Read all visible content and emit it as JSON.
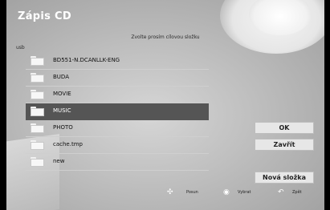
{
  "dialog": {
    "title": "Zápis CD",
    "subtitle": "Zvolte prosím cílovou složku",
    "path": "usb"
  },
  "folders": [
    {
      "label": "BD551-N.DCANLLK-ENG",
      "selected": false
    },
    {
      "label": "BUDA",
      "selected": false
    },
    {
      "label": "MOVIE",
      "selected": false
    },
    {
      "label": "MUSIC",
      "selected": true
    },
    {
      "label": "PHOTO",
      "selected": false
    },
    {
      "label": "cache.tmp",
      "selected": false
    },
    {
      "label": "new",
      "selected": false
    }
  ],
  "buttons": {
    "ok": "OK",
    "close": "Zavřít",
    "new_folder": "Nová složka"
  },
  "footer": {
    "move": "Posun",
    "select": "Vybrat",
    "back": "Zpět",
    "move_icon": "dpad-icon",
    "select_icon": "enter-circle-icon",
    "back_icon": "return-arrow-icon"
  }
}
